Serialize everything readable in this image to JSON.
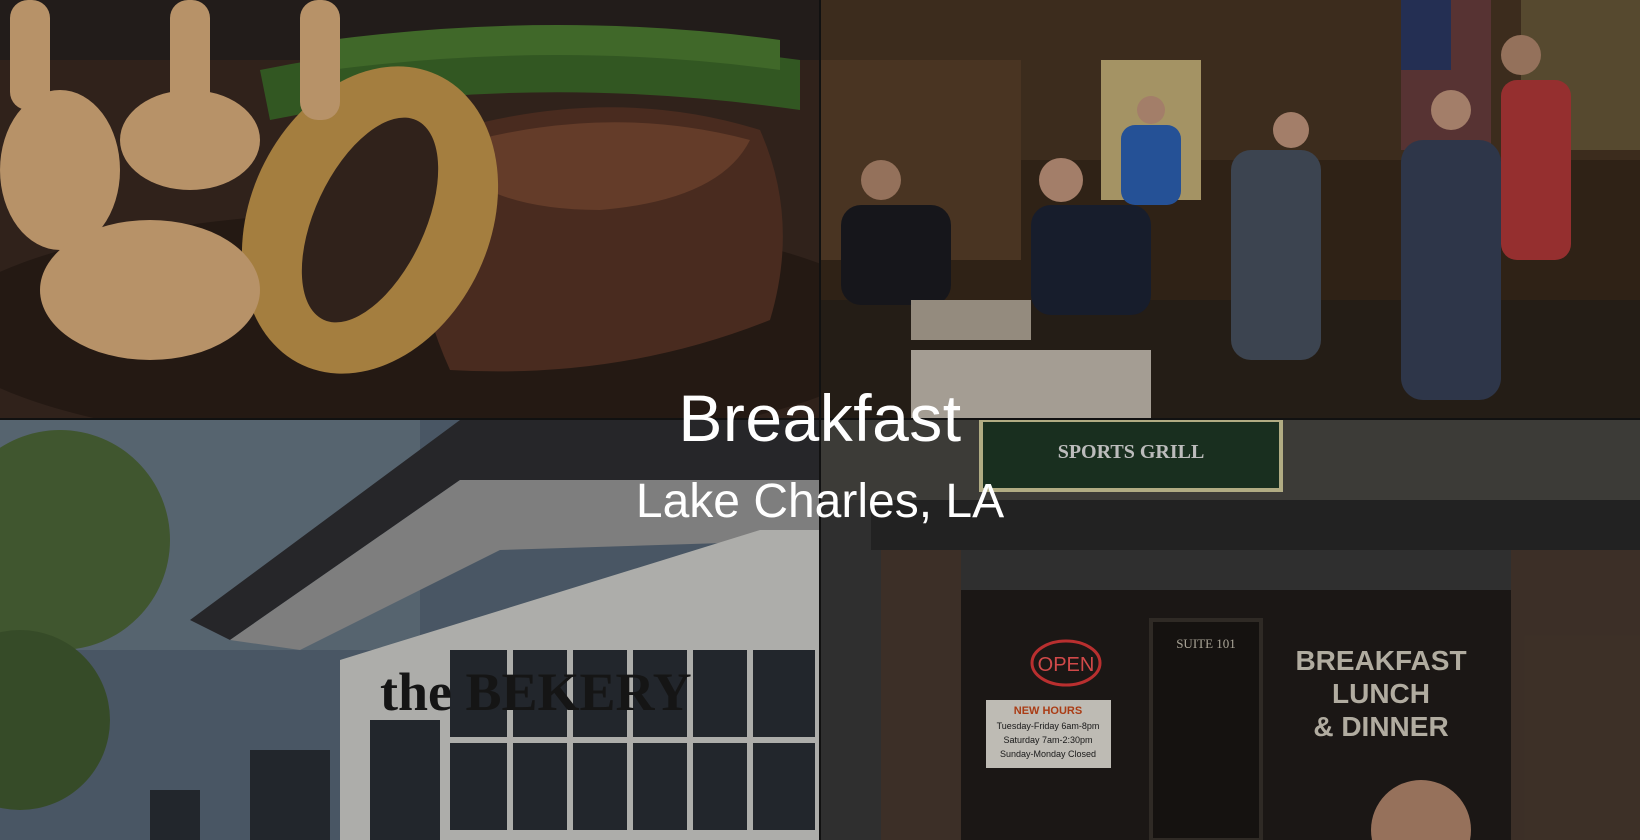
{
  "hero": {
    "title": "Breakfast",
    "subtitle": "Lake Charles, LA"
  },
  "photos": {
    "top_left": {
      "icon": "steak-shrimp-plate-photo"
    },
    "top_right": {
      "icon": "restaurant-interior-photo"
    },
    "bottom_left": {
      "icon": "bakery-building-photo",
      "sign_text": "the BEKERY"
    },
    "bottom_right": {
      "icon": "storefront-photo",
      "banner_text": "SPORTS GRILL",
      "open_sign": "OPEN",
      "suite_text": "SUITE 101",
      "hours_title": "NEW HOURS",
      "hours_lines": [
        "Tuesday-Friday 6am-8pm",
        "Saturday 7am-2:30pm",
        "Sunday-Monday Closed"
      ],
      "window_text": [
        "BREAKFAST",
        "LUNCH",
        "& DINNER"
      ]
    }
  },
  "colors": {
    "title_text": "#ffffff",
    "open_sign": "#e23a3a"
  }
}
